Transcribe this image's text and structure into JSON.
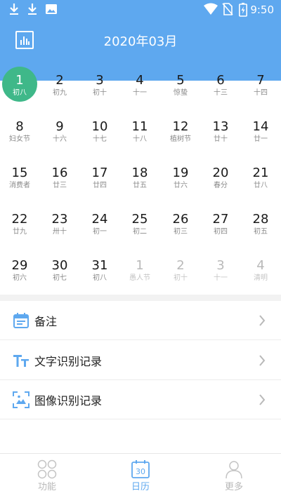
{
  "status_bar": {
    "time": "9:50",
    "left_icons": [
      "download-icon",
      "download-icon",
      "image-icon"
    ],
    "right_icons": [
      "wifi-icon",
      "no-sim-icon",
      "battery-charging-icon"
    ]
  },
  "header": {
    "title": "2020年03月",
    "background": "#5ea8ef",
    "left_icon": "calendar-chart-icon"
  },
  "calendar": {
    "selected_color": "#3fb889",
    "days": [
      {
        "day": "1",
        "lunar": "初八",
        "selected": true,
        "other_month": false
      },
      {
        "day": "2",
        "lunar": "初九",
        "selected": false,
        "other_month": false
      },
      {
        "day": "3",
        "lunar": "初十",
        "selected": false,
        "other_month": false
      },
      {
        "day": "4",
        "lunar": "十一",
        "selected": false,
        "other_month": false
      },
      {
        "day": "5",
        "lunar": "惊蛰",
        "selected": false,
        "other_month": false
      },
      {
        "day": "6",
        "lunar": "十三",
        "selected": false,
        "other_month": false
      },
      {
        "day": "7",
        "lunar": "十四",
        "selected": false,
        "other_month": false
      },
      {
        "day": "8",
        "lunar": "妇女节",
        "selected": false,
        "other_month": false
      },
      {
        "day": "9",
        "lunar": "十六",
        "selected": false,
        "other_month": false
      },
      {
        "day": "10",
        "lunar": "十七",
        "selected": false,
        "other_month": false
      },
      {
        "day": "11",
        "lunar": "十八",
        "selected": false,
        "other_month": false
      },
      {
        "day": "12",
        "lunar": "植树节",
        "selected": false,
        "other_month": false
      },
      {
        "day": "13",
        "lunar": "廿十",
        "selected": false,
        "other_month": false
      },
      {
        "day": "14",
        "lunar": "廿一",
        "selected": false,
        "other_month": false
      },
      {
        "day": "15",
        "lunar": "消费者",
        "selected": false,
        "other_month": false
      },
      {
        "day": "16",
        "lunar": "廿三",
        "selected": false,
        "other_month": false
      },
      {
        "day": "17",
        "lunar": "廿四",
        "selected": false,
        "other_month": false
      },
      {
        "day": "18",
        "lunar": "廿五",
        "selected": false,
        "other_month": false
      },
      {
        "day": "19",
        "lunar": "廿六",
        "selected": false,
        "other_month": false
      },
      {
        "day": "20",
        "lunar": "春分",
        "selected": false,
        "other_month": false
      },
      {
        "day": "21",
        "lunar": "廿八",
        "selected": false,
        "other_month": false
      },
      {
        "day": "22",
        "lunar": "廿九",
        "selected": false,
        "other_month": false
      },
      {
        "day": "23",
        "lunar": "卅十",
        "selected": false,
        "other_month": false
      },
      {
        "day": "24",
        "lunar": "初一",
        "selected": false,
        "other_month": false
      },
      {
        "day": "25",
        "lunar": "初二",
        "selected": false,
        "other_month": false
      },
      {
        "day": "26",
        "lunar": "初三",
        "selected": false,
        "other_month": false
      },
      {
        "day": "27",
        "lunar": "初四",
        "selected": false,
        "other_month": false
      },
      {
        "day": "28",
        "lunar": "初五",
        "selected": false,
        "other_month": false
      },
      {
        "day": "29",
        "lunar": "初六",
        "selected": false,
        "other_month": false
      },
      {
        "day": "30",
        "lunar": "初七",
        "selected": false,
        "other_month": false
      },
      {
        "day": "31",
        "lunar": "初八",
        "selected": false,
        "other_month": false
      },
      {
        "day": "1",
        "lunar": "愚人节",
        "selected": false,
        "other_month": true
      },
      {
        "day": "2",
        "lunar": "初十",
        "selected": false,
        "other_month": true
      },
      {
        "day": "3",
        "lunar": "十一",
        "selected": false,
        "other_month": true
      },
      {
        "day": "4",
        "lunar": "清明",
        "selected": false,
        "other_month": true
      }
    ]
  },
  "menu": {
    "items": [
      {
        "label": "备注",
        "icon": "notes-calendar-icon"
      },
      {
        "label": "文字识别记录",
        "icon": "text-recognition-icon"
      },
      {
        "label": "图像识别记录",
        "icon": "image-recognition-icon"
      }
    ],
    "icon_color": "#5ea8ef"
  },
  "tabbar": {
    "tabs": [
      {
        "label": "功能",
        "icon": "functions-grid-icon",
        "active": false
      },
      {
        "label": "日历",
        "icon": "calendar-30-icon",
        "active": true
      },
      {
        "label": "更多",
        "icon": "user-more-icon",
        "active": false
      }
    ],
    "active_color": "#5ea8ef",
    "inactive_color": "#b9b9b9"
  }
}
